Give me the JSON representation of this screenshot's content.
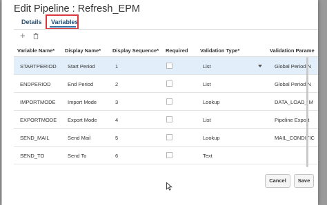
{
  "dialog": {
    "title": "Edit Pipeline : Refresh_EPM"
  },
  "tabs": [
    {
      "label": "Details"
    },
    {
      "label": "Variables"
    }
  ],
  "toolbar": {
    "add_icon": "plus-icon",
    "delete_icon": "trash-icon"
  },
  "table": {
    "headers": [
      "Variable Name*",
      "Display Name*",
      "Display Sequence*",
      "Required",
      "Validation Type*",
      "Validation Parame"
    ],
    "rows": [
      {
        "variable": "STARTPERIOD",
        "display": "Start Period",
        "seq": "1",
        "type": "List",
        "param": "Global Period N"
      },
      {
        "variable": "ENDPERIOD",
        "display": "End Period",
        "seq": "2",
        "type": "List",
        "param": "Global Period N"
      },
      {
        "variable": "IMPORTMODE",
        "display": "Import Mode",
        "seq": "3",
        "type": "Lookup",
        "param": "DATA_LOAD_IM"
      },
      {
        "variable": "EXPORTMODE",
        "display": "Export Mode",
        "seq": "4",
        "type": "List",
        "param": "Pipeline Export"
      },
      {
        "variable": "SEND_MAIL",
        "display": "Send Mail",
        "seq": "5",
        "type": "Lookup",
        "param": "MAIL_CONDITIC"
      },
      {
        "variable": "SEND_TO",
        "display": "Send To",
        "seq": "6",
        "type": "Text",
        "param": ""
      }
    ]
  },
  "buttons": {
    "cancel": "Cancel",
    "save": "Save"
  },
  "colors": {
    "selected_row": "#e2eef9",
    "tab_highlight": "#d9363e",
    "tab_accent": "#2e6fa7"
  }
}
